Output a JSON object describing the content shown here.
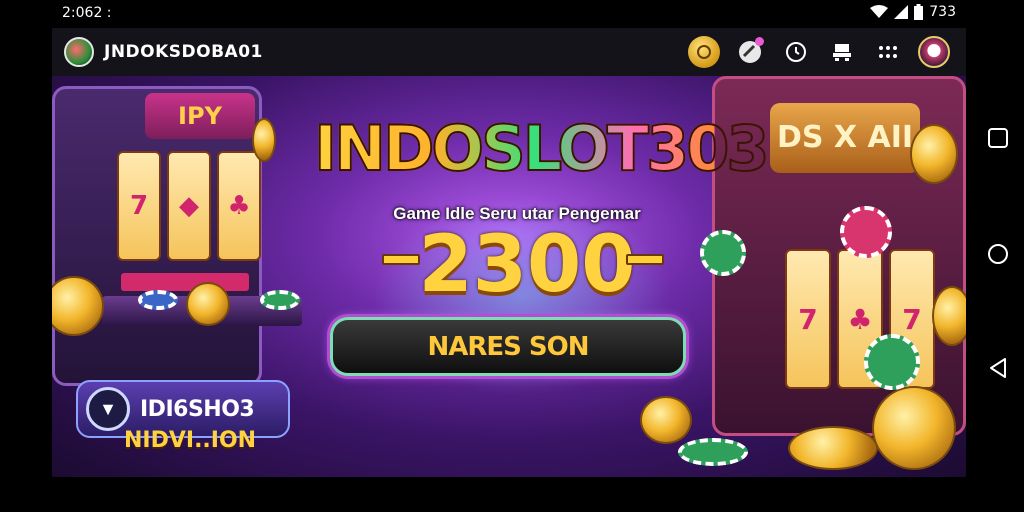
{
  "status_bar": {
    "time": "2:062 :",
    "battery_text": "733",
    "icons": [
      "wifi-icon",
      "signal-icon",
      "battery-icon"
    ]
  },
  "app_header": {
    "title": "JNDOKSDOBA01",
    "icons": [
      "coin-icon",
      "notification-icon",
      "clock-icon",
      "user-icon",
      "more-icon",
      "avatar"
    ]
  },
  "banner": {
    "brand": "INDOSLOT303",
    "subtitle": "Game Idle Seru utar Pengemar",
    "amount": "2300",
    "cta_label": "NARES SON",
    "badge_title": "IDI6SHO3",
    "badge_subtitle": "NIDVI..ION",
    "left_machine_sign": "IPY",
    "right_machine_sign": "DS X AII"
  },
  "nav": {
    "buttons": [
      "recents-button",
      "home-button",
      "back-button"
    ]
  }
}
